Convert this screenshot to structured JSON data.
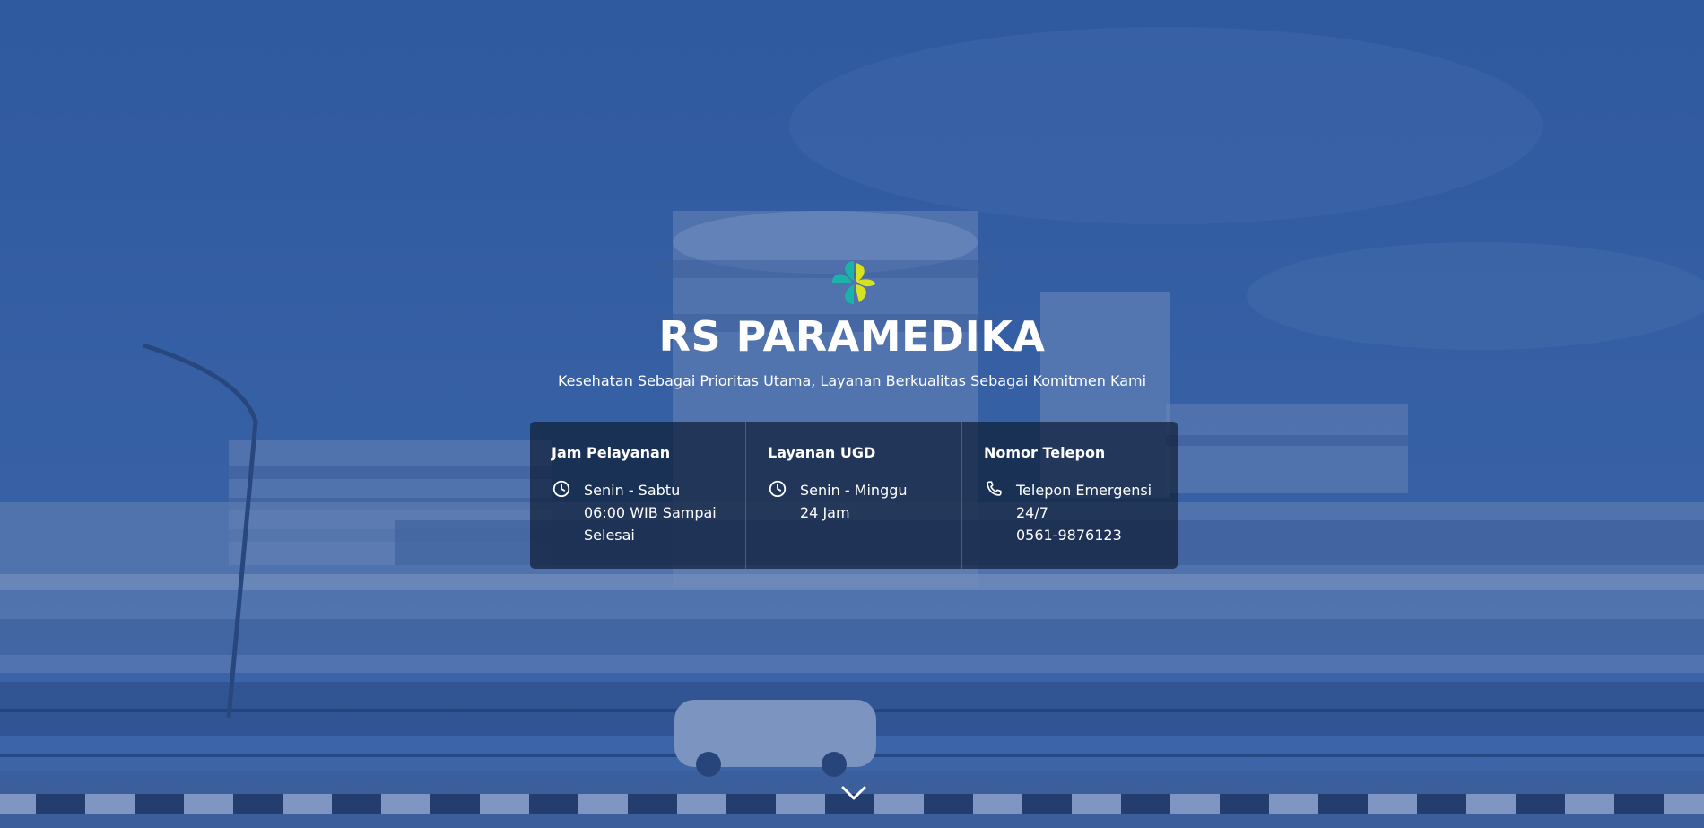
{
  "hero": {
    "title": "RS PARAMEDIKA",
    "tagline": "Kesehatan Sebagai Prioritas Utama, Layanan Berkualitas Sebagai Komitmen Kami"
  },
  "info": {
    "hours": {
      "heading": "Jam Pelayanan",
      "icon": "clock-icon",
      "line1": "Senin - Sabtu",
      "line2": "06:00 WIB Sampai",
      "line3": "Selesai"
    },
    "ugd": {
      "heading": "Layanan UGD",
      "icon": "clock-icon",
      "line1": "Senin - Minggu",
      "line2": "24 Jam"
    },
    "phone": {
      "heading": "Nomor Telepon",
      "icon": "phone-icon",
      "line1": "Telepon Emergensi",
      "line2": "24/7",
      "line3": "0561-9876123"
    }
  },
  "colors": {
    "overlay": "#264e96",
    "panel": "#0f1e37",
    "logo_teal": "#1bb3a8",
    "logo_yellow": "#d8e21f"
  }
}
